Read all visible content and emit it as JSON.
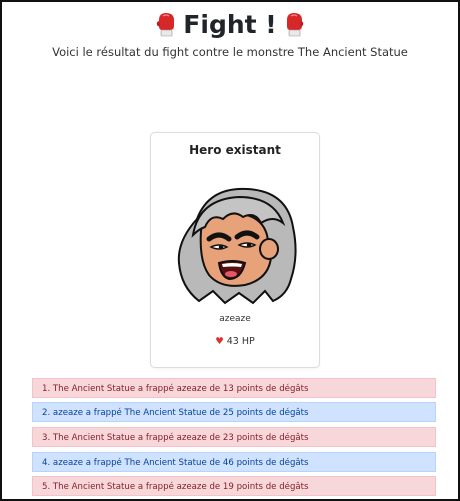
{
  "header": {
    "title": "Fight !",
    "subtitle": "Voici le résultat du fight contre le monstre The Ancient Statue",
    "title_icon": "boxing-glove-icon"
  },
  "hero_card": {
    "title": "Hero existant",
    "name": "azeaze",
    "hp_icon": "heart-icon",
    "hp": "43 HP"
  },
  "fight_log": [
    {
      "text": "1. The Ancient Statue a frappé azeaze de 13 points de dégâts",
      "kind": "monster",
      "color": "#f8d7da"
    },
    {
      "text": "2. azeaze a frappé The Ancient Statue de 25 points de dégâts",
      "kind": "hero",
      "color": "#cfe2ff"
    },
    {
      "text": "3. The Ancient Statue a frappé azeaze de 23 points de dégâts",
      "kind": "monster",
      "color": "#f8d7da"
    },
    {
      "text": "4. azeaze a frappé The Ancient Statue de 46 points de dégâts",
      "kind": "hero",
      "color": "#cfe2ff"
    },
    {
      "text": "5. The Ancient Statue a frappé azeaze de 19 points de dégâts",
      "kind": "monster",
      "color": "#f8d7da"
    }
  ]
}
